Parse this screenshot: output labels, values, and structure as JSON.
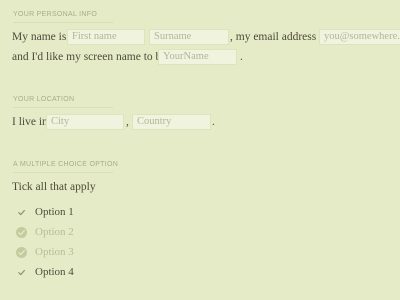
{
  "personal": {
    "section_label": "YOUR PERSONAL INFO",
    "text_my_name_is": "My name is",
    "first_name_placeholder": "First name",
    "surname_placeholder": "Surname",
    "text_email": ", my email address is",
    "email_placeholder": "you@somewhere.com",
    "text_screen_name": "and I'd like my screen name to be",
    "screen_name_placeholder": "YourName",
    "text_period": "."
  },
  "location": {
    "section_label": "YOUR LOCATION",
    "text_i_live_in": "I live in",
    "city_placeholder": "City",
    "text_comma": ",",
    "country_placeholder": "Country",
    "text_period": "."
  },
  "choices": {
    "section_label": "A MULTIPLE CHOICE OPTION",
    "prompt": "Tick all that apply",
    "options": [
      {
        "label": "Option 1",
        "checked": true
      },
      {
        "label": "Option 2",
        "checked": false
      },
      {
        "label": "Option 3",
        "checked": false
      },
      {
        "label": "Option 4",
        "checked": true
      }
    ]
  },
  "colors": {
    "background": "#e5ebc6",
    "field_background": "#f0f3dd",
    "text": "#4e4a3d",
    "placeholder": "#b3b69a",
    "section_label": "#a9ad87"
  }
}
